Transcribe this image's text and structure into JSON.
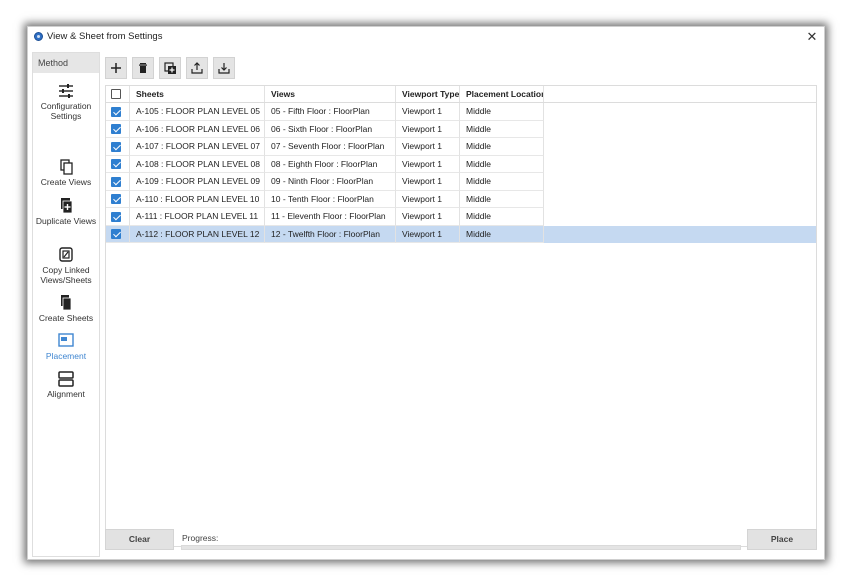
{
  "window": {
    "title": "View & Sheet from Settings",
    "close": "✕"
  },
  "sidebar": {
    "header": "Method",
    "items": [
      {
        "label": "Configuration Settings",
        "icon": "sliders-icon",
        "active": false
      },
      {
        "label": "Create Views",
        "icon": "copy-pages-icon",
        "active": false
      },
      {
        "label": "Duplicate Views",
        "icon": "duplicate-plus-icon",
        "active": false
      },
      {
        "label": "Copy Linked Views/Sheets",
        "icon": "link-copy-icon",
        "active": false
      },
      {
        "label": "Create Sheets",
        "icon": "sheets-stack-icon",
        "active": false
      },
      {
        "label": "Placement",
        "icon": "placement-window-icon",
        "active": true
      },
      {
        "label": "Alignment",
        "icon": "alignment-rows-icon",
        "active": false
      }
    ]
  },
  "toolbar": {
    "buttons": [
      "add-icon",
      "delete-icon",
      "add-copy-icon",
      "export-icon",
      "import-icon"
    ]
  },
  "table": {
    "columns": [
      "Sheets",
      "Views",
      "Viewport Type",
      "Placement Location"
    ],
    "rows": [
      {
        "checked": true,
        "sheet": "A-105 : FLOOR PLAN LEVEL 05",
        "view": "05 - Fifth Floor : FloorPlan",
        "viewport": "Viewport 1",
        "location": "Middle",
        "selected": false
      },
      {
        "checked": true,
        "sheet": "A-106 : FLOOR PLAN LEVEL 06",
        "view": "06 - Sixth Floor : FloorPlan",
        "viewport": "Viewport 1",
        "location": "Middle",
        "selected": false
      },
      {
        "checked": true,
        "sheet": "A-107 : FLOOR PLAN LEVEL 07",
        "view": "07 - Seventh Floor : FloorPlan",
        "viewport": "Viewport 1",
        "location": "Middle",
        "selected": false
      },
      {
        "checked": true,
        "sheet": "A-108 : FLOOR PLAN LEVEL 08",
        "view": "08 - Eighth Floor : FloorPlan",
        "viewport": "Viewport 1",
        "location": "Middle",
        "selected": false
      },
      {
        "checked": true,
        "sheet": "A-109 : FLOOR PLAN LEVEL 09",
        "view": "09 - Ninth Floor : FloorPlan",
        "viewport": "Viewport 1",
        "location": "Middle",
        "selected": false
      },
      {
        "checked": true,
        "sheet": "A-110 : FLOOR PLAN LEVEL 10",
        "view": "10 - Tenth Floor : FloorPlan",
        "viewport": "Viewport 1",
        "location": "Middle",
        "selected": false
      },
      {
        "checked": true,
        "sheet": "A-111 : FLOOR PLAN LEVEL 11",
        "view": "11 - Eleventh Floor : FloorPlan",
        "viewport": "Viewport 1",
        "location": "Middle",
        "selected": false
      },
      {
        "checked": true,
        "sheet": "A-112 : FLOOR PLAN LEVEL 12",
        "view": "12 - Twelfth Floor : FloorPlan",
        "viewport": "Viewport 1",
        "location": "Middle",
        "selected": true
      }
    ]
  },
  "footer": {
    "clear_label": "Clear",
    "progress_label": "Progress:",
    "progress_value": 0,
    "place_label": "Place"
  },
  "colors": {
    "accent": "#3f86d1",
    "selected_row": "#c5d9f1",
    "checkbox": "#2f7fd0"
  }
}
